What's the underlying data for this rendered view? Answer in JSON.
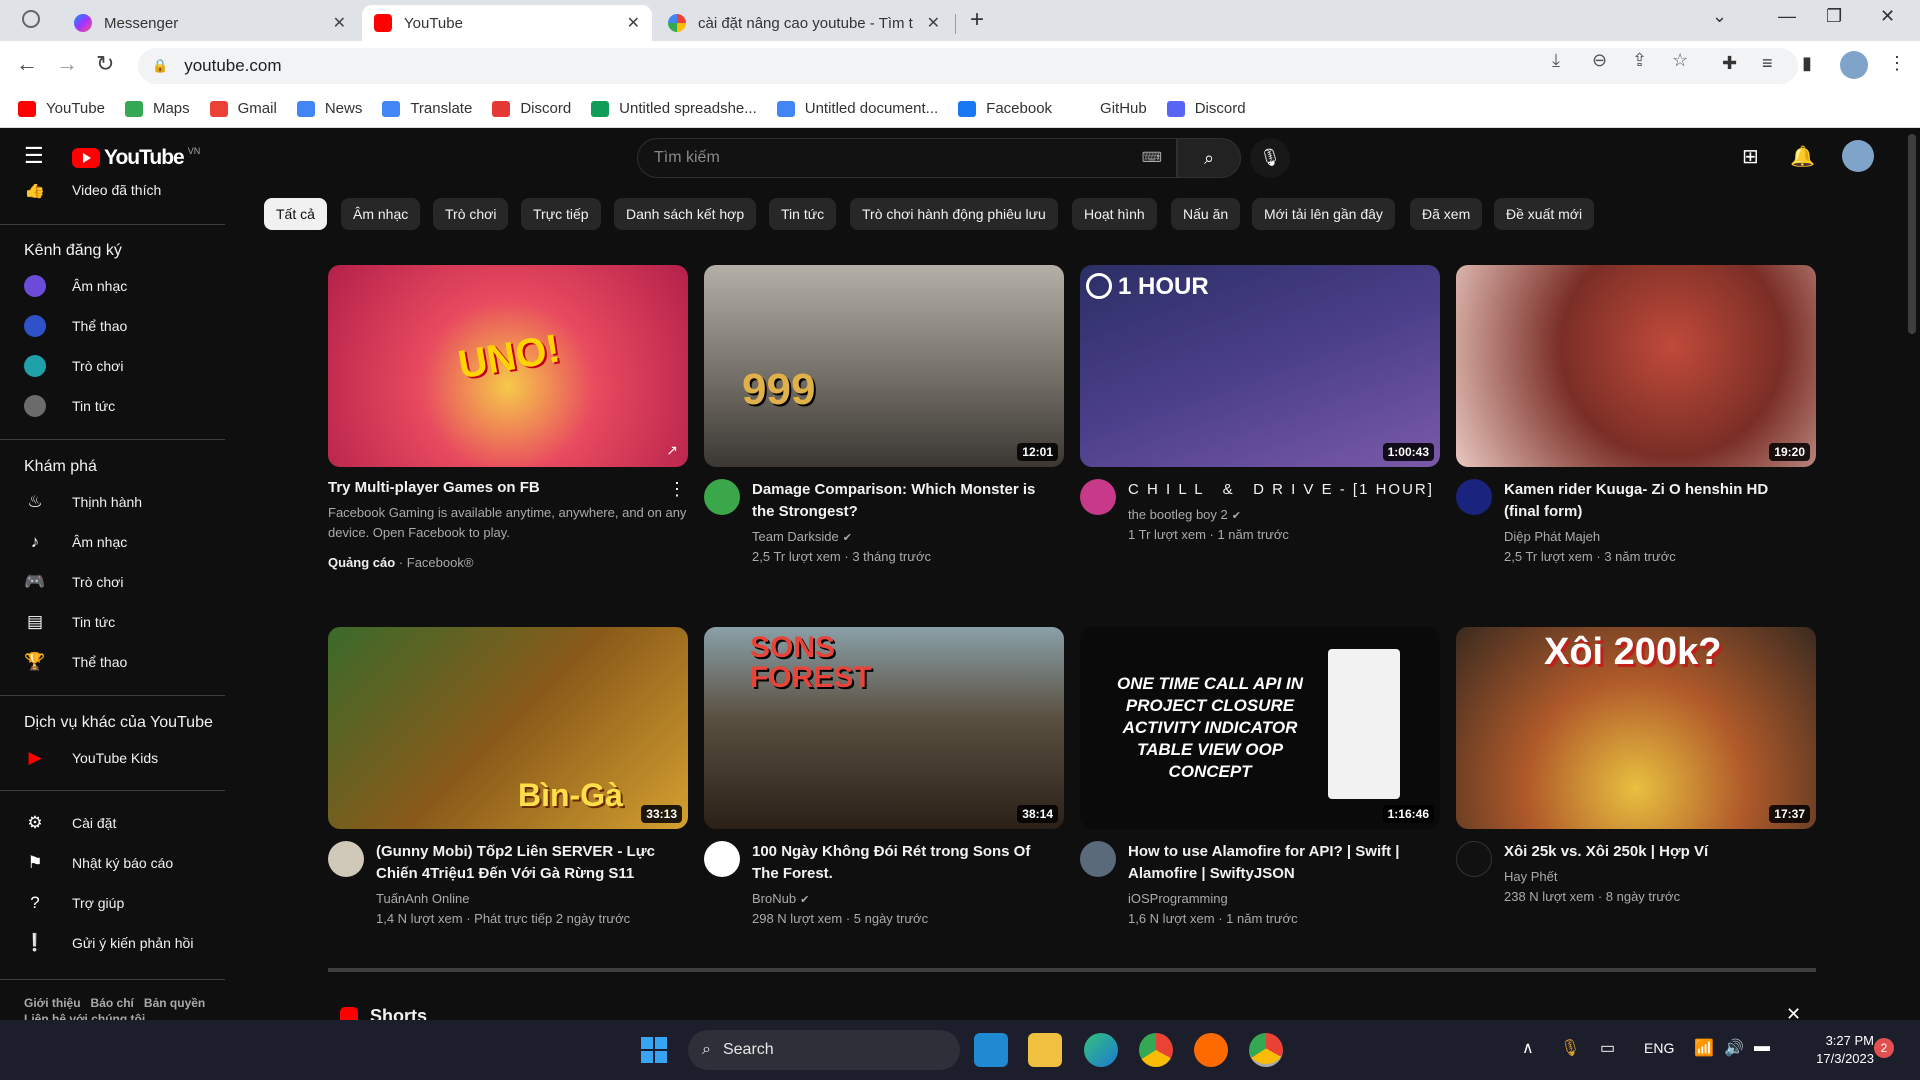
{
  "browser": {
    "tabs": [
      {
        "title": "Messenger",
        "active": false
      },
      {
        "title": "YouTube",
        "active": true
      },
      {
        "title": "cài đặt nâng cao youtube - Tìm t",
        "active": false
      }
    ],
    "new_tab": "+",
    "address": "youtube.com",
    "bookmarks": [
      {
        "label": "YouTube",
        "color": "#ff0000"
      },
      {
        "label": "Maps",
        "color": "#34a853"
      },
      {
        "label": "Gmail",
        "color": "#ea4335"
      },
      {
        "label": "News",
        "color": "#4285f4"
      },
      {
        "label": "Translate",
        "color": "#4285f4"
      },
      {
        "label": "Discord",
        "color": "#e53935"
      },
      {
        "label": "Untitled spreadshe...",
        "color": "#0f9d58"
      },
      {
        "label": "Untitled document...",
        "color": "#4285f4"
      },
      {
        "label": "Facebook",
        "color": "#1877f2"
      },
      {
        "label": "GitHub",
        "color": "#ffffff"
      },
      {
        "label": "Discord",
        "color": "#5865f2"
      }
    ]
  },
  "youtube": {
    "logo_word": "YouTube",
    "country": "VN",
    "search_placeholder": "Tìm kiếm",
    "sidebar": {
      "liked": "Video đã thích",
      "subscriptions_heading": "Kênh đăng ký",
      "subscriptions": [
        {
          "label": "Âm nhạc",
          "color": "#6b4bd8"
        },
        {
          "label": "Thể thao",
          "color": "#2f52c9"
        },
        {
          "label": "Trò chơi",
          "color": "#20a0a8"
        },
        {
          "label": "Tin tức",
          "color": "#6c6c6c"
        }
      ],
      "explore_heading": "Khám phá",
      "explore": [
        {
          "label": "Thịnh hành",
          "icon": "fire-icon"
        },
        {
          "label": "Âm nhạc",
          "icon": "music-icon"
        },
        {
          "label": "Trò chơi",
          "icon": "gamepad-icon"
        },
        {
          "label": "Tin tức",
          "icon": "news-icon"
        },
        {
          "label": "Thể thao",
          "icon": "trophy-icon"
        }
      ],
      "more_heading": "Dịch vụ khác của YouTube",
      "more": [
        {
          "label": "YouTube Kids"
        }
      ],
      "settings": [
        {
          "label": "Cài đặt",
          "icon": "gear-icon"
        },
        {
          "label": "Nhật ký báo cáo",
          "icon": "flag-icon"
        },
        {
          "label": "Trợ giúp",
          "icon": "help-icon"
        },
        {
          "label": "Gửi ý kiến phản hồi",
          "icon": "feedback-icon"
        }
      ],
      "footer_links": [
        "Giới thiệu",
        "Báo chí",
        "Bản quyền"
      ],
      "footer_line2": "Liên hệ với chúng tôi"
    },
    "chips": [
      "Tất cả",
      "Âm nhạc",
      "Trò chơi",
      "Trực tiếp",
      "Danh sách kết hợp",
      "Tin tức",
      "Trò chơi hành động phiêu lưu",
      "Hoạt hình",
      "Nấu ăn",
      "Mới tải lên gần đây",
      "Đã xem",
      "Đề xuất mới"
    ],
    "ad": {
      "title": "Try Multi-player Games on FB",
      "description": "Facebook Gaming is available anytime, anywhere, and on any device. Open Facebook to play.",
      "label": "Quảng cáo",
      "advertiser": "Facebook®",
      "thumb_text": "UNO!"
    },
    "videos": [
      {
        "title": "Damage Comparison: Which Monster is the Strongest?",
        "channel": "Team Darkside",
        "verified": true,
        "views": "2,5 Tr lượt xem",
        "age": "3 tháng trước",
        "duration": "12:01",
        "thumb_text": "999",
        "thumb_color": "#6e6a62",
        "avatar_color": "#3aa84a"
      },
      {
        "title": "C H I L L   &   D R I V E - [1 HOUR]",
        "channel": "the bootleg boy 2",
        "verified": true,
        "views": "1 Tr lượt xem",
        "age": "1 năm trước",
        "duration": "1:00:43",
        "thumb_text": "1 HOUR",
        "thumb_color": "#3a3f74",
        "avatar_color": "#c73a8a"
      },
      {
        "title": "Kamen rider Kuuga- Zi O henshin HD (final form)",
        "channel": "Diệp Phát Majeh",
        "verified": false,
        "views": "2,5 Tr lượt xem",
        "age": "3 năm trước",
        "duration": "19:20",
        "thumb_text": "",
        "thumb_color": "#7a2e26",
        "avatar_color": "#1a237e"
      },
      {
        "title": "(Gunny Mobi) Tốp2 Liên SERVER - Lực Chiến 4Triệu1 Đến Với Gà Rừng S11",
        "channel": "TuấnAnh Online",
        "verified": false,
        "views": "1,4 N lượt xem",
        "age": "Phát trực tiếp 2 ngày trước",
        "duration": "33:13",
        "thumb_text": "Bìn-Gà",
        "thumb_color": "#8a5a1a",
        "avatar_color": "#d0c8b8"
      },
      {
        "title": "100 Ngày Không Đói Rét trong Sons Of The Forest.",
        "channel": "BroNub",
        "verified": true,
        "views": "298 N lượt xem",
        "age": "5 ngày trước",
        "duration": "38:14",
        "thumb_text": "SONS FOREST",
        "thumb_color": "#4a4030",
        "avatar_color": "#ffffff"
      },
      {
        "title": "How to use Alamofire for API? | Swift | Alamofire | SwiftyJSON",
        "channel": "iOSProgramming",
        "verified": false,
        "views": "1,6 N lượt xem",
        "age": "1 năm trước",
        "duration": "1:16:46",
        "thumb_text": "ONE TIME CALL API IN PROJECT CLOSURE ACTIVITY INDICATOR TABLE VIEW OOP CONCEPT",
        "thumb_color": "#0a0a0a",
        "avatar_color": "#5a6a7a"
      },
      {
        "title": "Xôi 25k vs. Xôi 250k | Hợp Ví",
        "channel": "Hay Phết",
        "verified": false,
        "views": "238 N lượt xem",
        "age": "8 ngày trước",
        "duration": "17:37",
        "thumb_text": "Xôi 200k?",
        "thumb_color": "#b05a2a",
        "avatar_color": "#111111"
      }
    ],
    "shorts_label": "Shorts"
  },
  "taskbar": {
    "search": "Search",
    "lang": "ENG",
    "time": "3:27 PM",
    "date": "17/3/2023",
    "notifications": "2"
  }
}
